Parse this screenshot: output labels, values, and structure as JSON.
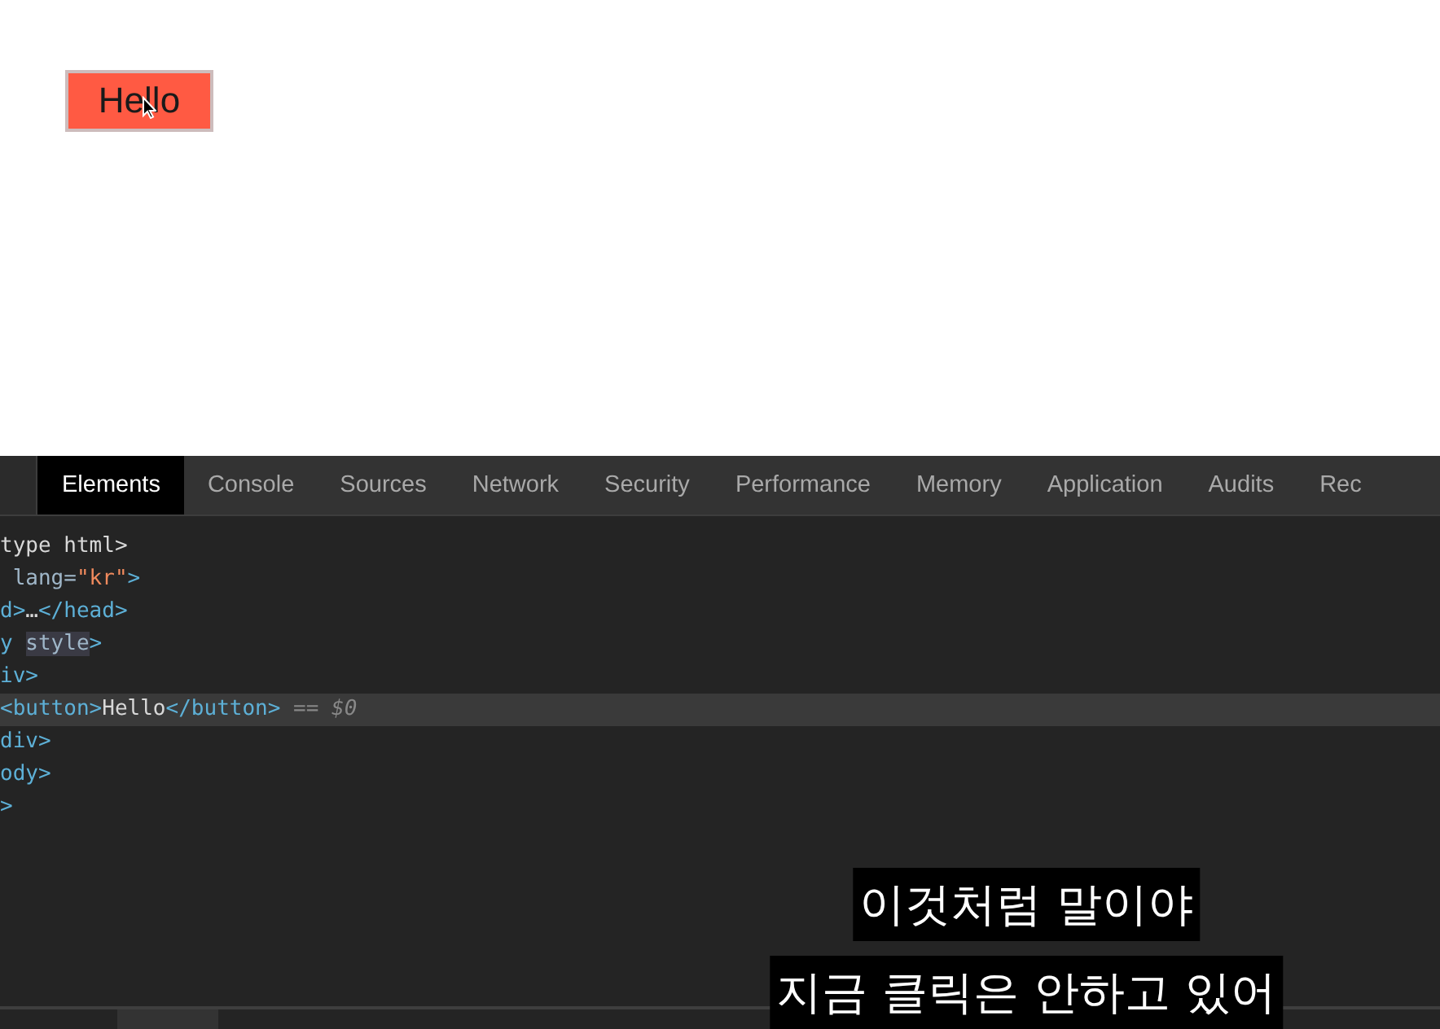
{
  "page": {
    "button": "Hello"
  },
  "devtools": {
    "tabs": [
      {
        "label": "Elements",
        "selected": true
      },
      {
        "label": "Console",
        "selected": false
      },
      {
        "label": "Sources",
        "selected": false
      },
      {
        "label": "Network",
        "selected": false
      },
      {
        "label": "Security",
        "selected": false
      },
      {
        "label": "Performance",
        "selected": false
      },
      {
        "label": "Memory",
        "selected": false
      },
      {
        "label": "Application",
        "selected": false
      },
      {
        "label": "Audits",
        "selected": false
      },
      {
        "label": "Rec",
        "selected": false
      }
    ],
    "lines": [
      {
        "selected": false,
        "tokens": [
          {
            "kind": "text",
            "text": "type html>"
          }
        ]
      },
      {
        "selected": false,
        "tokens": [
          {
            "kind": "attr",
            "text": " lang="
          },
          {
            "kind": "string",
            "text": "\"kr\""
          },
          {
            "kind": "tag",
            "text": ">"
          }
        ]
      },
      {
        "selected": false,
        "tokens": [
          {
            "kind": "tag",
            "text": "d>"
          },
          {
            "kind": "text",
            "text": "…"
          },
          {
            "kind": "tag",
            "text": "</head>"
          }
        ]
      },
      {
        "selected": false,
        "tokens": [
          {
            "kind": "tag",
            "text": "y "
          },
          {
            "kind": "attr-hl",
            "text": "style"
          },
          {
            "kind": "tag",
            "text": ">"
          }
        ]
      },
      {
        "selected": false,
        "tokens": [
          {
            "kind": "tag",
            "text": "iv>"
          }
        ]
      },
      {
        "selected": true,
        "tokens": [
          {
            "kind": "tag",
            "text": "<button>"
          },
          {
            "kind": "text",
            "text": "Hello"
          },
          {
            "kind": "tag",
            "text": "</button>"
          },
          {
            "kind": "hint",
            "text": " == $0"
          }
        ]
      },
      {
        "selected": false,
        "tokens": [
          {
            "kind": "tag",
            "text": "div>"
          }
        ]
      },
      {
        "selected": false,
        "tokens": [
          {
            "kind": "tag",
            "text": "ody>"
          }
        ]
      },
      {
        "selected": false,
        "tokens": [
          {
            "kind": "tag",
            "text": ">"
          }
        ]
      }
    ]
  },
  "subtitles": [
    "이것처럼 말이야",
    "지금 클릭은 안하고 있어"
  ]
}
